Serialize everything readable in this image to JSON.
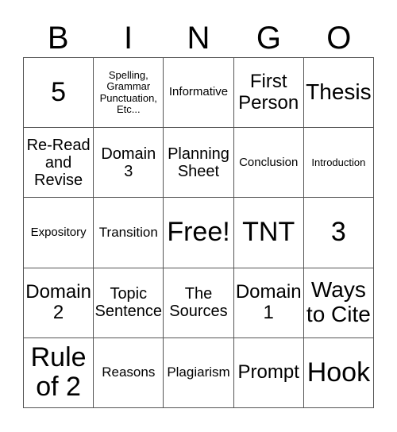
{
  "header": {
    "letters": [
      "B",
      "I",
      "N",
      "G",
      "O"
    ]
  },
  "cells": [
    [
      "5",
      "Spelling,\nGrammar\nPunctuation,\nEtc...",
      "Informative",
      "First\nPerson",
      "Thesis"
    ],
    [
      "Re-Read\nand\nRevise",
      "Domain\n3",
      "Planning\nSheet",
      "Conclusion",
      "Introduction"
    ],
    [
      "Expository",
      "Transition",
      "Free!",
      "TNT",
      "3"
    ],
    [
      "Domain\n2",
      "Topic\nSentence",
      "The\nSources",
      "Domain\n1",
      "Ways\nto Cite"
    ],
    [
      "Rule\nof 2",
      "Reasons",
      "Plagiarism",
      "Prompt",
      "Hook"
    ]
  ]
}
